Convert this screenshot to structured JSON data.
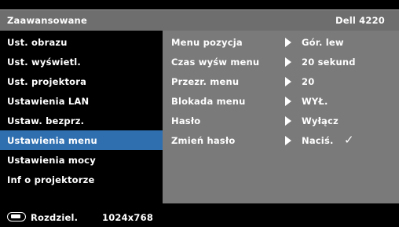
{
  "header": {
    "title": "Zaawansowane",
    "model": "Dell 4220"
  },
  "menu": {
    "items": [
      {
        "label": "Ust. obrazu"
      },
      {
        "label": "Ust. wyświetl."
      },
      {
        "label": "Ust. projektora"
      },
      {
        "label": "Ustawienia LAN"
      },
      {
        "label": "Ustaw. bezprz."
      },
      {
        "label": "Ustawienia menu"
      },
      {
        "label": "Ustawienia mocy"
      },
      {
        "label": "Inf o projektorze"
      }
    ],
    "selected_index": 5
  },
  "settings": {
    "rows": [
      {
        "label": "Menu pozycja",
        "value": "Gór. lew"
      },
      {
        "label": "Czas wyśw menu",
        "value": "20 sekund"
      },
      {
        "label": "Przezr. menu",
        "value": "20"
      },
      {
        "label": "Blokada menu",
        "value": "WYŁ."
      },
      {
        "label": "Hasło",
        "value": "Wyłącz"
      },
      {
        "label": "Zmień hasło",
        "value": "Naciś.",
        "mark": "✓"
      }
    ]
  },
  "status": {
    "label": "Rozdziel.",
    "value": "1024x768",
    "icon": "monitor-connector-icon"
  },
  "colors": {
    "highlight": "#2f6fb0",
    "panel": "#7a7a7a",
    "titlebar": "#6e6e6e"
  }
}
